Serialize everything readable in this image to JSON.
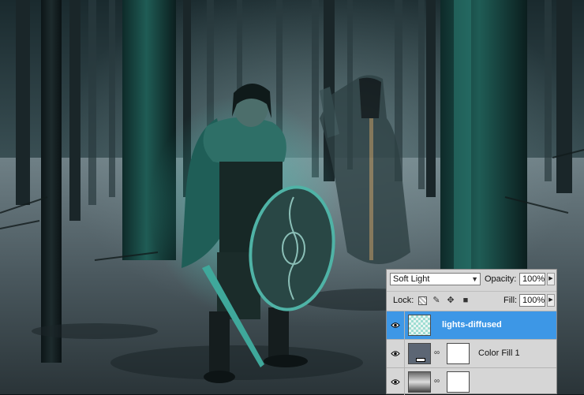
{
  "layers_panel": {
    "blend_mode": "Soft Light",
    "opacity_label": "Opacity:",
    "opacity_value": "100%",
    "lock_label": "Lock:",
    "fill_label": "Fill:",
    "fill_value": "100%",
    "lock_icons": [
      "transparency-lock-icon",
      "brush-icon",
      "move-icon",
      "padlock-icon"
    ],
    "layers": [
      {
        "name": "lights-diffused",
        "selected": true,
        "visible": true,
        "thumbnail": "checkerboard-teal"
      },
      {
        "name": "Color Fill 1",
        "selected": false,
        "visible": true,
        "thumbnail": "solid-slate",
        "mask": "white"
      },
      {
        "name": "",
        "selected": false,
        "visible": true,
        "thumbnail": "gradient-map"
      }
    ]
  },
  "colors": {
    "selection": "#3d97e6",
    "panel_bg": "#d6d6d6",
    "fill_swatch": "#5c6674",
    "teal_glow": "#2fb6a8"
  }
}
